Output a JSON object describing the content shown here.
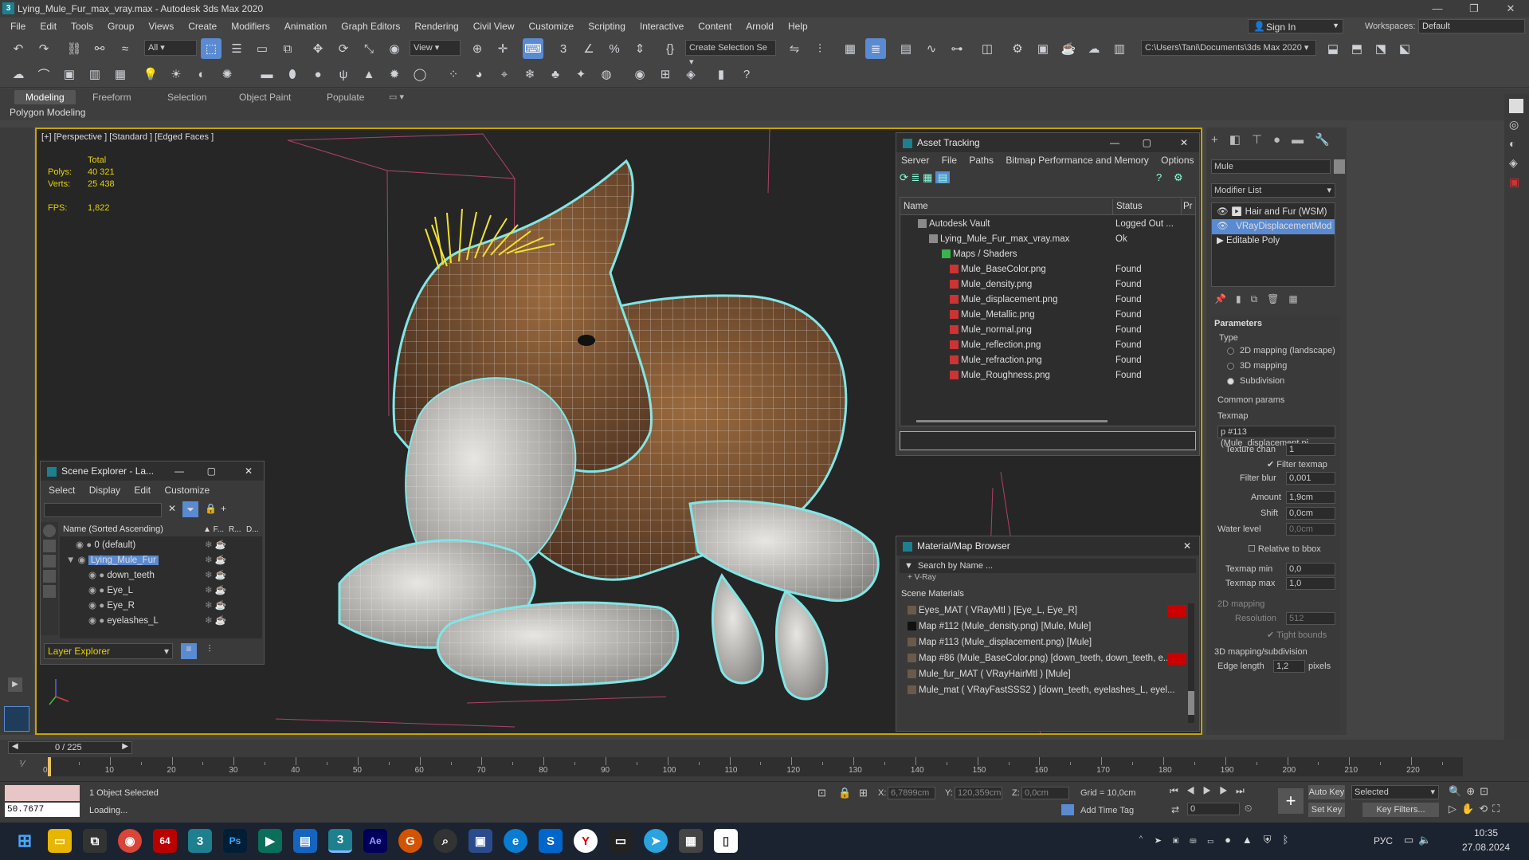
{
  "window": {
    "title": "Lying_Mule_Fur_max_vray.max - Autodesk 3ds Max 2020",
    "minimize": "—",
    "maximize": "❐",
    "close": "✕"
  },
  "menu": [
    "File",
    "Edit",
    "Tools",
    "Group",
    "Views",
    "Create",
    "Modifiers",
    "Animation",
    "Graph Editors",
    "Rendering",
    "Civil View",
    "Customize",
    "Scripting",
    "Interactive",
    "Content",
    "Arnold",
    "Help"
  ],
  "account": {
    "sign_in": "Sign In",
    "workspaces_label": "Workspaces:",
    "workspace": "Default"
  },
  "toolbar": {
    "filter": "All",
    "view": "View",
    "selection_set": "Create Selection Se",
    "path": "C:\\Users\\Tani\\Documents\\3ds Max 2020"
  },
  "ribbon": {
    "tabs": [
      "Modeling",
      "Freeform",
      "Selection",
      "Object Paint",
      "Populate"
    ],
    "sub": "Polygon Modeling"
  },
  "viewport": {
    "label": "[+] [Perspective ] [Standard ] [Edged Faces ]",
    "stats": {
      "total": "Total",
      "polys_label": "Polys:",
      "polys": "40 321",
      "verts_label": "Verts:",
      "verts": "25 438",
      "fps_label": "FPS:",
      "fps": "1,822"
    }
  },
  "asset_tracking": {
    "title": "Asset Tracking",
    "menu": [
      "Server",
      "File",
      "Paths",
      "Bitmap Performance and Memory",
      "Options"
    ],
    "col_name": "Name",
    "col_status": "Status",
    "col_p": "Pr",
    "rows": [
      {
        "name": "Autodesk Vault",
        "status": "Logged Out ..."
      },
      {
        "name": "Lying_Mule_Fur_max_vray.max",
        "status": "Ok"
      },
      {
        "name": "Maps / Shaders",
        "status": ""
      },
      {
        "name": "Mule_BaseColor.png",
        "status": "Found"
      },
      {
        "name": "Mule_density.png",
        "status": "Found"
      },
      {
        "name": "Mule_displacement.png",
        "status": "Found"
      },
      {
        "name": "Mule_Metallic.png",
        "status": "Found"
      },
      {
        "name": "Mule_normal.png",
        "status": "Found"
      },
      {
        "name": "Mule_reflection.png",
        "status": "Found"
      },
      {
        "name": "Mule_refraction.png",
        "status": "Found"
      },
      {
        "name": "Mule_Roughness.png",
        "status": "Found"
      }
    ]
  },
  "scene_explorer": {
    "title": "Scene Explorer - La...",
    "menu": [
      "Select",
      "Display",
      "Edit",
      "Customize"
    ],
    "col_name": "Name (Sorted Ascending)",
    "col_f": "▲ F...",
    "col_r": "R...",
    "col_d": "D...",
    "rows": [
      "0 (default)",
      "Lying_Mule_Fur",
      "down_teeth",
      "Eye_L",
      "Eye_R",
      "eyelashes_L"
    ],
    "footer": "Layer Explorer"
  },
  "material_browser": {
    "title": "Material/Map Browser",
    "search": "Search by Name ...",
    "vray": "+ V-Ray",
    "scene_materials": "Scene Materials",
    "items": [
      "Eyes_MAT  ( VRayMtl ) [Eye_L, Eye_R]",
      "Map #112 (Mule_density.png) [Mule, Mule]",
      "Map #113 (Mule_displacement.png) [Mule]",
      "Map #86 (Mule_BaseColor.png) [down_teeth, down_teeth, e...",
      "Mule_fur_MAT  ( VRayHairMtl ) [Mule]",
      "Mule_mat  ( VRayFastSSS2 ) [down_teeth, eyelashes_L, eyel..."
    ]
  },
  "command_panel": {
    "object_name": "Mule",
    "modifier_list": "Modifier List",
    "stack": [
      "Hair and Fur (WSM)",
      "VRayDisplacementMod",
      "Editable Poly"
    ],
    "parameters": "Parameters",
    "type": "Type",
    "type_options": [
      "2D mapping (landscape)",
      "3D mapping",
      "Subdivision"
    ],
    "common": "Common params",
    "texmap": "Texmap",
    "texmap_value": "p #113 (Mule_displacement.pi",
    "texture_chan": "Texture chan",
    "texture_chan_value": "1",
    "filter_texmap": "Filter texmap",
    "filter_blur": "Filter blur",
    "filter_blur_value": "0,001",
    "amount": "Amount",
    "amount_value": "1,9cm",
    "shift": "Shift",
    "shift_value": "0,0cm",
    "water_level": "Water level",
    "water_level_value": "0,0cm",
    "relative": "Relative to bbox",
    "texmap_min": "Texmap min",
    "texmap_min_value": "0,0",
    "texmap_max": "Texmap max",
    "texmap_max_value": "1,0",
    "mapping_2d": "2D mapping",
    "resolution": "Resolution",
    "resolution_value": "512",
    "tight": "Tight bounds",
    "mapping_3d": "3D mapping/subdivision",
    "edge_length": "Edge length",
    "edge_length_value": "1,2",
    "pixels": "pixels"
  },
  "timeline": {
    "frame": "0 / 225",
    "ticks": [
      "0",
      "10",
      "20",
      "30",
      "40",
      "50",
      "60",
      "70",
      "80",
      "90",
      "100",
      "110",
      "120",
      "130",
      "140",
      "150",
      "160",
      "170",
      "180",
      "190",
      "200",
      "210",
      "220"
    ]
  },
  "status": {
    "value": "50.7677",
    "selected": "1 Object Selected",
    "loading": "Loading...",
    "x_label": "X:",
    "x": "6,7899cm",
    "y_label": "Y:",
    "y": "120,359cm",
    "z_label": "Z:",
    "z": "0,0cm",
    "grid": "Grid = 10,0cm",
    "add_time_tag": "Add Time Tag",
    "auto_key": "Auto Key",
    "set_key": "Set Key",
    "selected_dd": "Selected",
    "key_filters": "Key Filters...",
    "frame_field": "0"
  },
  "taskbar": {
    "lang": "РУС",
    "time": "10:35",
    "date": "27.08.2024"
  }
}
